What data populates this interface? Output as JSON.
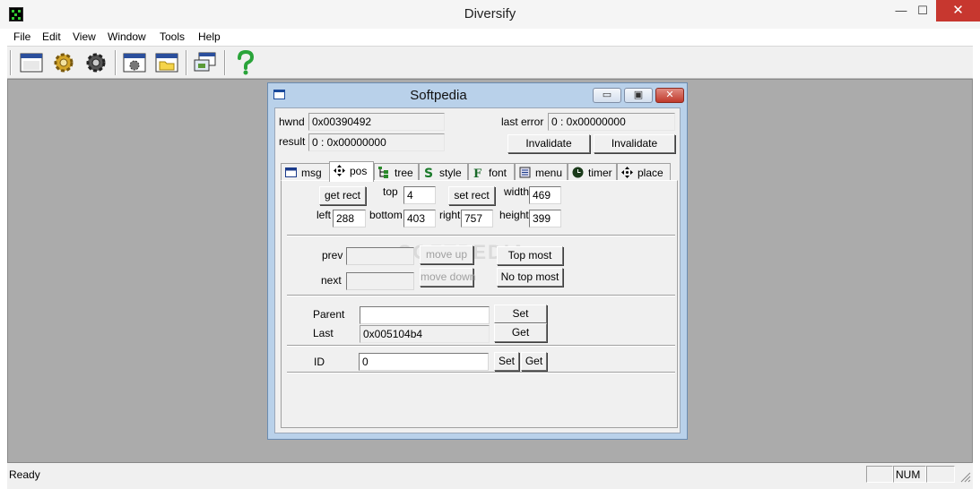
{
  "window": {
    "title": "Diversify",
    "min": "—",
    "max": "☐",
    "close": "✕"
  },
  "menu": [
    "File",
    "Edit",
    "View",
    "Window",
    "Tools",
    "Help"
  ],
  "toolbar": {
    "icons": [
      "window-icon",
      "gear-icon",
      "gear-dark-icon",
      "window-gear-icon",
      "window-folder-icon",
      "window-network-icon",
      "help-question-icon"
    ]
  },
  "status": {
    "text": "Ready",
    "num": "NUM"
  },
  "child": {
    "title": "Softpedia",
    "min": "▭",
    "restore": "▣",
    "close": "✕",
    "hwnd_label": "hwnd",
    "hwnd_value": "0x00390492",
    "result_label": "result",
    "result_value": "0 : 0x00000000",
    "last_error_label": "last error",
    "last_error_value": "0 : 0x00000000",
    "invalidate1": "Invalidate",
    "invalidate2": "Invalidate"
  },
  "tabs": [
    {
      "label": "msg",
      "icon": "window-icon"
    },
    {
      "label": "pos",
      "icon": "move-arrows-icon"
    },
    {
      "label": "tree",
      "icon": "tree-icon"
    },
    {
      "label": "style",
      "icon": "dollar-style-icon"
    },
    {
      "label": "font",
      "icon": "font-f-icon"
    },
    {
      "label": "menu",
      "icon": "menu-list-icon"
    },
    {
      "label": "timer",
      "icon": "clock-icon"
    },
    {
      "label": "place",
      "icon": "move-arrows-icon"
    }
  ],
  "pos": {
    "get_rect": "get rect",
    "set_rect": "set rect",
    "top_label": "top",
    "top_value": "4",
    "width_label": "width",
    "width_value": "469",
    "left_label": "left",
    "left_value": "288",
    "bottom_label": "bottom",
    "bottom_value": "403",
    "right_label": "right",
    "right_value": "757",
    "height_label": "height",
    "height_value": "399",
    "prev_label": "prev",
    "prev_value": "",
    "next_label": "next",
    "next_value": "",
    "move_up": "move up",
    "move_down": "move down",
    "top_most": "Top most",
    "no_top_most": "No top most",
    "parent_label": "Parent",
    "parent_value": "",
    "last_label": "Last",
    "last_value": "0x005104b4",
    "set": "Set",
    "get": "Get",
    "id_label": "ID",
    "id_value": "0",
    "id_set": "Set",
    "id_get": "Get"
  },
  "watermark": "SOFTPEDIA"
}
